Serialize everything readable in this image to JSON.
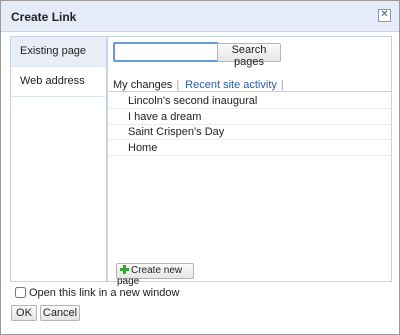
{
  "dialog": {
    "title": "Create Link",
    "close_symbol": "✕"
  },
  "sidebar": {
    "items": [
      {
        "label": "Existing page",
        "active": true
      },
      {
        "label": "Web address",
        "active": false
      }
    ]
  },
  "search": {
    "value": "",
    "placeholder": "",
    "button_label": "Search pages"
  },
  "tabs": [
    {
      "label": "My changes",
      "active": true
    },
    {
      "label": "Recent site activity",
      "active": false
    }
  ],
  "pages": [
    "Lincoln's second inaugural",
    "I have a dream",
    "Saint Crispen's Day",
    "Home"
  ],
  "create_button": {
    "label": "Create new page",
    "icon": "plus-icon",
    "icon_color": "#3aa33a"
  },
  "footer": {
    "new_window_label": "Open this link in a new window",
    "new_window_checked": false,
    "ok_label": "OK",
    "cancel_label": "Cancel"
  }
}
